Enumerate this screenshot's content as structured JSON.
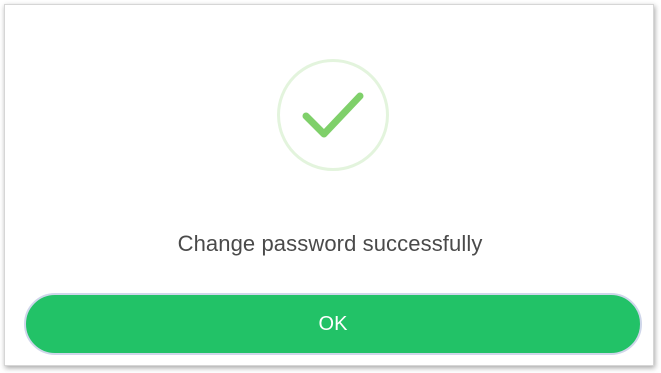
{
  "dialog": {
    "message": "Change password successfully",
    "ok_label": "OK",
    "icon": "check-icon",
    "colors": {
      "accent": "#22c267",
      "check": "#7fd06a",
      "circle_border": "#e3f4dd",
      "text": "#4a4a4a"
    }
  }
}
